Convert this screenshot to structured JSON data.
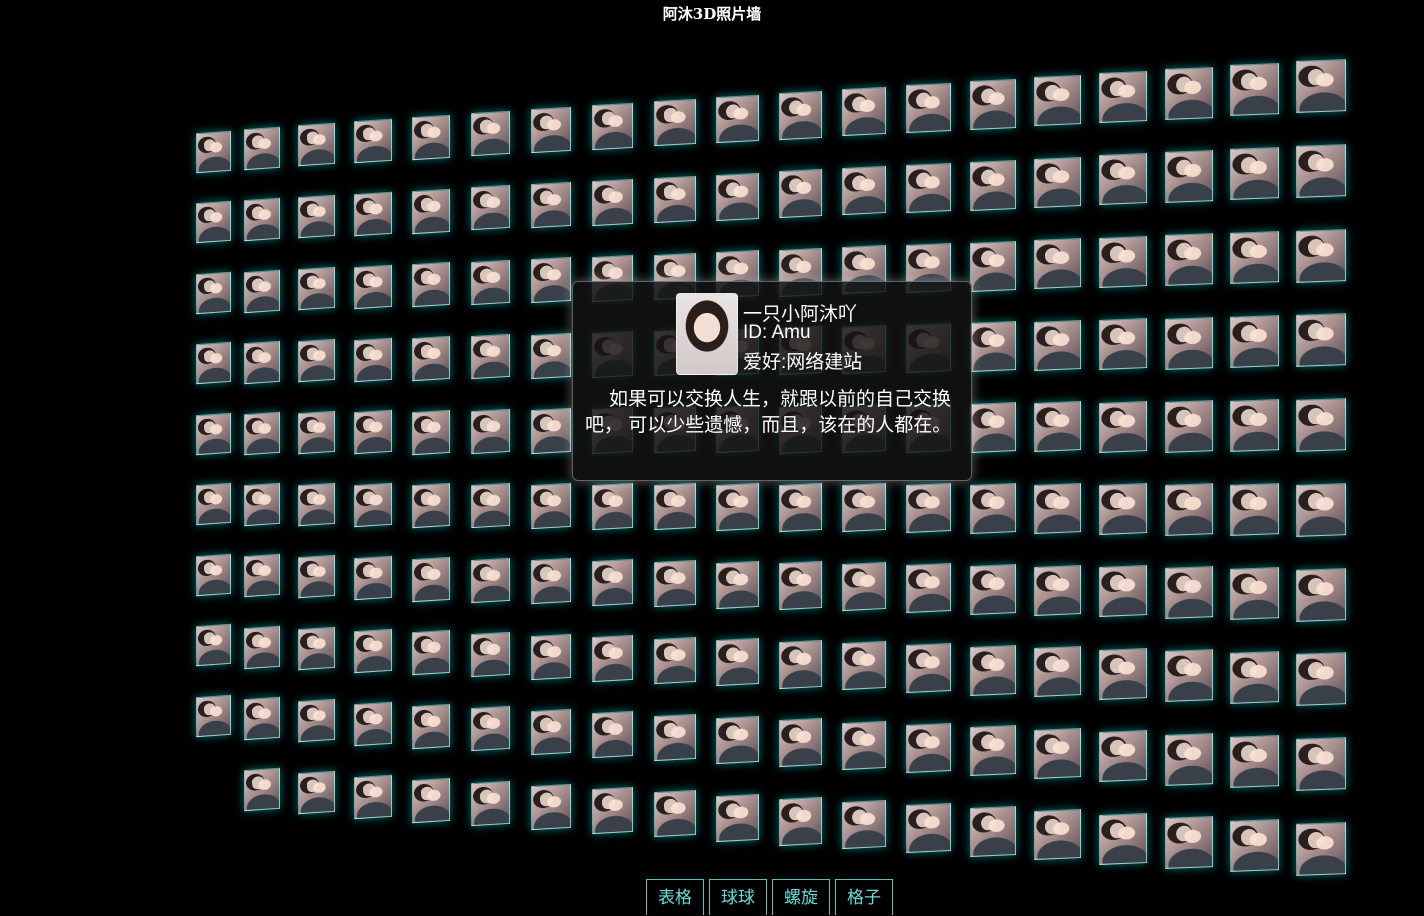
{
  "title": "阿沐3D照片墙",
  "wall": {
    "rows": 10,
    "cols": 19,
    "photo": "portrait-photo"
  },
  "card": {
    "name": "一只小阿沐吖",
    "id": "ID: Amu",
    "hobby": "爱好:网络建站",
    "quote": "如果可以交换人生，就跟以前的自己交换吧， 可以少些遗憾，而且，该在的人都在。"
  },
  "nav": {
    "table": "表格",
    "sphere": "球球",
    "helix": "螺旋",
    "grid": "格子"
  },
  "colors": {
    "background": "#000000",
    "accent": "#7fffff",
    "text": "#ffffff"
  }
}
